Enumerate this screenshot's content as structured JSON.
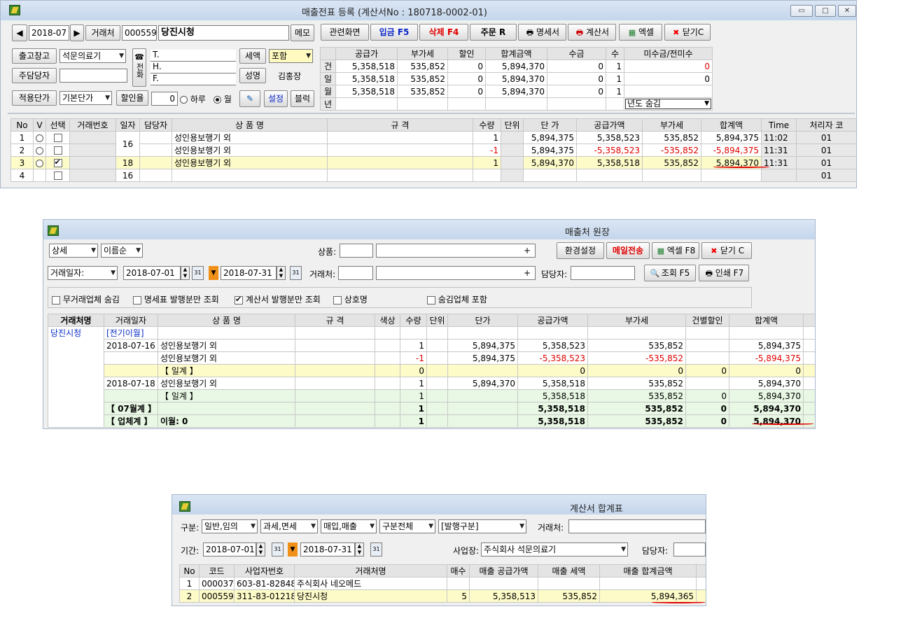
{
  "w1": {
    "title": "매출전표 등록 (계산서No : 180718-0002-01)",
    "month": "2018-07",
    "client_label": "거래처",
    "client_code": "000559",
    "client_name": "당진시청",
    "memo": "메모",
    "toolbar": [
      "관련화면",
      "입금 F5",
      "삭제 F4",
      "주문 R",
      "명세서",
      "계산서",
      "엑셀",
      "닫기C"
    ],
    "warehouse_label": "출고창고",
    "warehouse": "석문의료기",
    "manager_label": "주담당자",
    "rate_label": "적용단가",
    "rate": "기본단가",
    "discount_label": "할인율",
    "discount": "0",
    "radio_day": "하루",
    "radio_month": "월",
    "phone_label": "전화",
    "t": "T.",
    "h": "H.",
    "f": "F.",
    "tax_label": "세액",
    "tax": "포함",
    "name_label": "성명",
    "name": "김홍장",
    "set_btn": "설정",
    "block_btn": "블럭",
    "sum_headers": [
      "공급가",
      "부가세",
      "할인",
      "합계금액",
      "수금",
      "수",
      "미수금/전미수"
    ],
    "sum_rows": [
      {
        "k": "건",
        "v": [
          "5,358,518",
          "535,852",
          "0",
          "5,894,370",
          "0",
          "1",
          "0"
        ]
      },
      {
        "k": "일",
        "v": [
          "5,358,518",
          "535,852",
          "0",
          "5,894,370",
          "0",
          "1",
          "0"
        ]
      },
      {
        "k": "월",
        "v": [
          "5,358,518",
          "535,852",
          "0",
          "5,894,370",
          "0",
          "1",
          ""
        ]
      },
      {
        "k": "년",
        "v": [
          "",
          "",
          "",
          "",
          "",
          "",
          ""
        ]
      }
    ],
    "year_hide": "년도 숨김",
    "headers": [
      "No",
      "V",
      "선택",
      "거래번호",
      "일자",
      "담당자",
      "상 품 명",
      "규 격",
      "수량",
      "단위",
      "단 가",
      "공급가액",
      "부가세",
      "합계액",
      "Time",
      "처리자 코"
    ],
    "rows": [
      {
        "no": "1",
        "date": "16",
        "item": "성인용보행기 외",
        "qty": "1",
        "price": "5,894,375",
        "supply": "5,358,523",
        "vat": "535,852",
        "total": "5,894,375",
        "time": "11:02",
        "code": "01"
      },
      {
        "no": "2",
        "date": "",
        "item": "성인용보행기 외",
        "qty": "-1",
        "price": "5,894,375",
        "supply": "-5,358,523",
        "vat": "-535,852",
        "total": "-5,894,375",
        "time": "11:31",
        "code": "01"
      },
      {
        "no": "3",
        "date": "18",
        "item": "성인용보행기 외",
        "qty": "1",
        "price": "5,894,370",
        "supply": "5,358,518",
        "vat": "535,852",
        "total": "5,894,370",
        "time": "11:31",
        "code": "01"
      },
      {
        "no": "4",
        "date": "16",
        "item": "",
        "qty": "",
        "price": "",
        "supply": "",
        "vat": "",
        "total": "",
        "time": "",
        "code": "01"
      }
    ]
  },
  "w2": {
    "title": "매출처 원장",
    "detail": "상세",
    "sort": "이름순",
    "product_label": "상품:",
    "env_btn": "환경설정",
    "mail_btn": "메일전송",
    "excel_btn": "엑셀 F8",
    "close_btn": "닫기 C",
    "date_type": "거래일자:",
    "date_from": "2018-07-01",
    "date_to": "2018-07-31",
    "client_label": "거래처:",
    "manager_label": "담당자:",
    "search_btn": "조회 F5",
    "print_btn": "인쇄 F7",
    "opt1": "무거래업체 숨김",
    "opt2": "명세표 발행분만 조회",
    "opt3": "계산서 발행분만 조회",
    "opt4": "상호명",
    "opt5": "숨김업체 포함",
    "headers": [
      "거래처명",
      "거래일자",
      "상 품 명",
      "규 격",
      "색상",
      "수량",
      "단위",
      "단가",
      "공급가액",
      "부가세",
      "건별할인",
      "합계액"
    ],
    "client": "당진시청",
    "carry": "[전기이월]",
    "rows": [
      {
        "date": "2018-07-16",
        "item": "성인용보행기 외",
        "qty": "1",
        "price": "5,894,375",
        "supply": "5,358,523",
        "vat": "535,852",
        "disc": "",
        "total": "5,894,375"
      },
      {
        "date": "",
        "item": "성인용보행기 외",
        "qty": "-1",
        "price": "5,894,375",
        "supply": "-5,358,523",
        "vat": "-535,852",
        "disc": "",
        "total": "-5,894,375"
      },
      {
        "date": "",
        "item": "【 일계 】",
        "qty": "0",
        "price": "",
        "supply": "0",
        "vat": "0",
        "disc": "0",
        "total": "0"
      },
      {
        "date": "2018-07-18",
        "item": "성인용보행기 외",
        "qty": "1",
        "price": "5,894,370",
        "supply": "5,358,518",
        "vat": "535,852",
        "disc": "",
        "total": "5,894,370"
      },
      {
        "date": "",
        "item": "【 일계 】",
        "qty": "1",
        "price": "",
        "supply": "5,358,518",
        "vat": "535,852",
        "disc": "0",
        "total": "5,894,370"
      }
    ],
    "month_total": {
      "label": "【 07월계 】",
      "qty": "1",
      "supply": "5,358,518",
      "vat": "535,852",
      "disc": "0",
      "total": "5,894,370"
    },
    "grand_total": {
      "label": "【 업체계 】",
      "carry": "이월: 0",
      "qty": "1",
      "supply": "5,358,518",
      "vat": "535,852",
      "disc": "0",
      "total": "5,894,370"
    }
  },
  "w3": {
    "title": "계산서 합계표",
    "kind_label": "구분:",
    "kind": "일반,임의",
    "tax": "과세,면세",
    "inout": "매입,매출",
    "div": "구분전체",
    "issue": "[발행구분]",
    "client_label": "거래처:",
    "period_label": "기간:",
    "date_from": "2018-07-01",
    "date_to": "2018-07-31",
    "biz_label": "사업장:",
    "biz": "주식회사 석문의료기",
    "manager_label": "담당자:",
    "headers": [
      "No",
      "코드",
      "사업자번호",
      "거래처명",
      "매수",
      "매출 공급가액",
      "매출 세액",
      "매출 합계금액"
    ],
    "rows": [
      {
        "no": "1",
        "code": "000037",
        "bizno": "603-81-82848",
        "name": "주식회사 네오메드",
        "cnt": "",
        "supply": "",
        "vat": "",
        "total": ""
      },
      {
        "no": "2",
        "code": "000559",
        "bizno": "311-83-01218",
        "name": "당진시청",
        "cnt": "5",
        "supply": "5,358,513",
        "vat": "535,852",
        "total": "5,894,365"
      }
    ]
  }
}
